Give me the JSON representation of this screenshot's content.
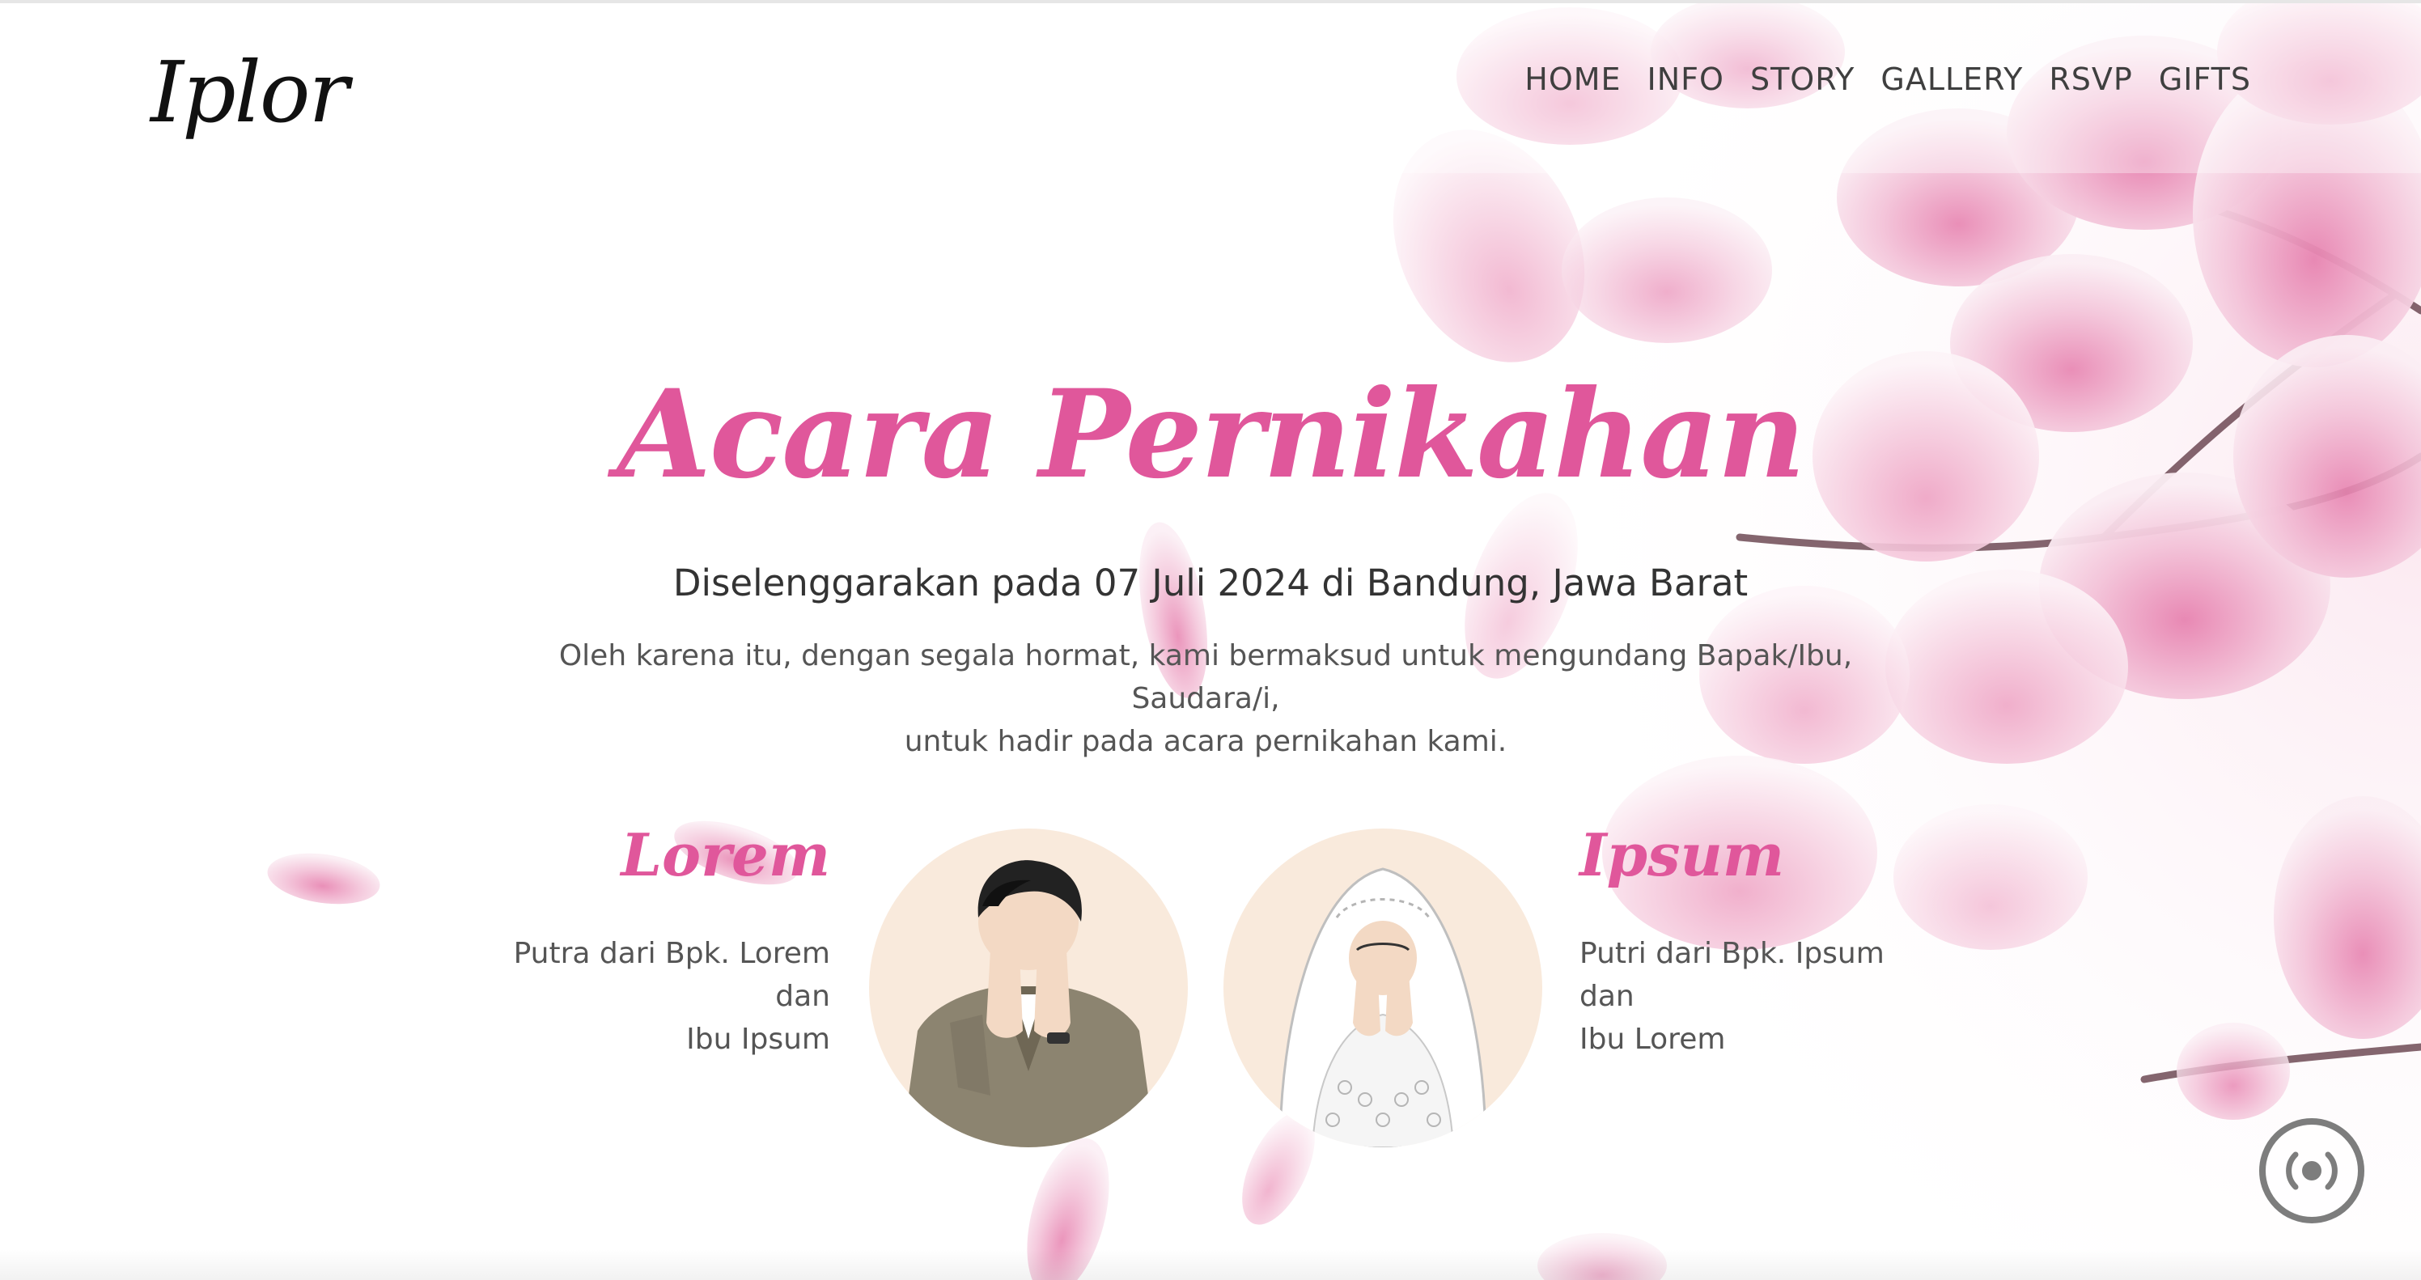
{
  "nav": {
    "brand": "Iplor",
    "links": [
      "HOME",
      "INFO",
      "STORY",
      "GALLERY",
      "RSVP",
      "GIFTS"
    ]
  },
  "hero": {
    "title": "Acara Pernikahan",
    "date_line": "Diselenggarakan pada 07 Juli 2024 di Bandung, Jawa Barat",
    "invitation_line1": "Oleh karena itu, dengan segala hormat, kami bermaksud untuk mengundang Bapak/Ibu, Saudara/i,",
    "invitation_line2": "untuk hadir pada acara pernikahan kami."
  },
  "couple": {
    "groom": {
      "name": "Lorem",
      "parents": [
        "Putra dari Bpk. Lorem",
        "dan",
        "Ibu Ipsum"
      ]
    },
    "bride": {
      "name": "Ipsum",
      "parents": [
        "Putri dari Bpk. Ipsum",
        "dan",
        "Ibu Lorem"
      ]
    }
  },
  "music_button": {
    "icon": "radio-broadcast-icon"
  },
  "colors": {
    "accent": "#e0579b",
    "avatar_bg": "#f9eadc",
    "blossom": "#f4bcd4",
    "blossom_deep": "#e88cb5",
    "text_dark": "#333333",
    "text_body": "#555555"
  }
}
